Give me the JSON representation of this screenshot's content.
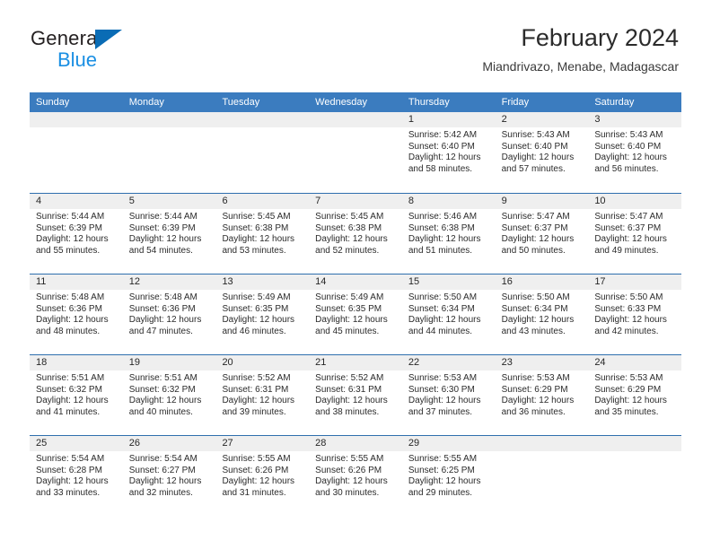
{
  "brand": {
    "name_top": "General",
    "name_bottom": "Blue",
    "accent_color": "#1a8fe3",
    "triangle_color": "#0a6cb5"
  },
  "header": {
    "title": "February 2024",
    "subtitle": "Miandrivazo, Menabe, Madagascar"
  },
  "calendar": {
    "header_color": "#3b7cbf",
    "row_divider_color": "#2f6fae",
    "day_strip_color": "#efefef",
    "weekdays": [
      "Sunday",
      "Monday",
      "Tuesday",
      "Wednesday",
      "Thursday",
      "Friday",
      "Saturday"
    ],
    "weeks": [
      [
        {
          "day": "",
          "sunrise": "",
          "sunset": "",
          "daylight_line1": "",
          "daylight_line2": ""
        },
        {
          "day": "",
          "sunrise": "",
          "sunset": "",
          "daylight_line1": "",
          "daylight_line2": ""
        },
        {
          "day": "",
          "sunrise": "",
          "sunset": "",
          "daylight_line1": "",
          "daylight_line2": ""
        },
        {
          "day": "",
          "sunrise": "",
          "sunset": "",
          "daylight_line1": "",
          "daylight_line2": ""
        },
        {
          "day": "1",
          "sunrise": "Sunrise: 5:42 AM",
          "sunset": "Sunset: 6:40 PM",
          "daylight_line1": "Daylight: 12 hours",
          "daylight_line2": "and 58 minutes."
        },
        {
          "day": "2",
          "sunrise": "Sunrise: 5:43 AM",
          "sunset": "Sunset: 6:40 PM",
          "daylight_line1": "Daylight: 12 hours",
          "daylight_line2": "and 57 minutes."
        },
        {
          "day": "3",
          "sunrise": "Sunrise: 5:43 AM",
          "sunset": "Sunset: 6:40 PM",
          "daylight_line1": "Daylight: 12 hours",
          "daylight_line2": "and 56 minutes."
        }
      ],
      [
        {
          "day": "4",
          "sunrise": "Sunrise: 5:44 AM",
          "sunset": "Sunset: 6:39 PM",
          "daylight_line1": "Daylight: 12 hours",
          "daylight_line2": "and 55 minutes."
        },
        {
          "day": "5",
          "sunrise": "Sunrise: 5:44 AM",
          "sunset": "Sunset: 6:39 PM",
          "daylight_line1": "Daylight: 12 hours",
          "daylight_line2": "and 54 minutes."
        },
        {
          "day": "6",
          "sunrise": "Sunrise: 5:45 AM",
          "sunset": "Sunset: 6:38 PM",
          "daylight_line1": "Daylight: 12 hours",
          "daylight_line2": "and 53 minutes."
        },
        {
          "day": "7",
          "sunrise": "Sunrise: 5:45 AM",
          "sunset": "Sunset: 6:38 PM",
          "daylight_line1": "Daylight: 12 hours",
          "daylight_line2": "and 52 minutes."
        },
        {
          "day": "8",
          "sunrise": "Sunrise: 5:46 AM",
          "sunset": "Sunset: 6:38 PM",
          "daylight_line1": "Daylight: 12 hours",
          "daylight_line2": "and 51 minutes."
        },
        {
          "day": "9",
          "sunrise": "Sunrise: 5:47 AM",
          "sunset": "Sunset: 6:37 PM",
          "daylight_line1": "Daylight: 12 hours",
          "daylight_line2": "and 50 minutes."
        },
        {
          "day": "10",
          "sunrise": "Sunrise: 5:47 AM",
          "sunset": "Sunset: 6:37 PM",
          "daylight_line1": "Daylight: 12 hours",
          "daylight_line2": "and 49 minutes."
        }
      ],
      [
        {
          "day": "11",
          "sunrise": "Sunrise: 5:48 AM",
          "sunset": "Sunset: 6:36 PM",
          "daylight_line1": "Daylight: 12 hours",
          "daylight_line2": "and 48 minutes."
        },
        {
          "day": "12",
          "sunrise": "Sunrise: 5:48 AM",
          "sunset": "Sunset: 6:36 PM",
          "daylight_line1": "Daylight: 12 hours",
          "daylight_line2": "and 47 minutes."
        },
        {
          "day": "13",
          "sunrise": "Sunrise: 5:49 AM",
          "sunset": "Sunset: 6:35 PM",
          "daylight_line1": "Daylight: 12 hours",
          "daylight_line2": "and 46 minutes."
        },
        {
          "day": "14",
          "sunrise": "Sunrise: 5:49 AM",
          "sunset": "Sunset: 6:35 PM",
          "daylight_line1": "Daylight: 12 hours",
          "daylight_line2": "and 45 minutes."
        },
        {
          "day": "15",
          "sunrise": "Sunrise: 5:50 AM",
          "sunset": "Sunset: 6:34 PM",
          "daylight_line1": "Daylight: 12 hours",
          "daylight_line2": "and 44 minutes."
        },
        {
          "day": "16",
          "sunrise": "Sunrise: 5:50 AM",
          "sunset": "Sunset: 6:34 PM",
          "daylight_line1": "Daylight: 12 hours",
          "daylight_line2": "and 43 minutes."
        },
        {
          "day": "17",
          "sunrise": "Sunrise: 5:50 AM",
          "sunset": "Sunset: 6:33 PM",
          "daylight_line1": "Daylight: 12 hours",
          "daylight_line2": "and 42 minutes."
        }
      ],
      [
        {
          "day": "18",
          "sunrise": "Sunrise: 5:51 AM",
          "sunset": "Sunset: 6:32 PM",
          "daylight_line1": "Daylight: 12 hours",
          "daylight_line2": "and 41 minutes."
        },
        {
          "day": "19",
          "sunrise": "Sunrise: 5:51 AM",
          "sunset": "Sunset: 6:32 PM",
          "daylight_line1": "Daylight: 12 hours",
          "daylight_line2": "and 40 minutes."
        },
        {
          "day": "20",
          "sunrise": "Sunrise: 5:52 AM",
          "sunset": "Sunset: 6:31 PM",
          "daylight_line1": "Daylight: 12 hours",
          "daylight_line2": "and 39 minutes."
        },
        {
          "day": "21",
          "sunrise": "Sunrise: 5:52 AM",
          "sunset": "Sunset: 6:31 PM",
          "daylight_line1": "Daylight: 12 hours",
          "daylight_line2": "and 38 minutes."
        },
        {
          "day": "22",
          "sunrise": "Sunrise: 5:53 AM",
          "sunset": "Sunset: 6:30 PM",
          "daylight_line1": "Daylight: 12 hours",
          "daylight_line2": "and 37 minutes."
        },
        {
          "day": "23",
          "sunrise": "Sunrise: 5:53 AM",
          "sunset": "Sunset: 6:29 PM",
          "daylight_line1": "Daylight: 12 hours",
          "daylight_line2": "and 36 minutes."
        },
        {
          "day": "24",
          "sunrise": "Sunrise: 5:53 AM",
          "sunset": "Sunset: 6:29 PM",
          "daylight_line1": "Daylight: 12 hours",
          "daylight_line2": "and 35 minutes."
        }
      ],
      [
        {
          "day": "25",
          "sunrise": "Sunrise: 5:54 AM",
          "sunset": "Sunset: 6:28 PM",
          "daylight_line1": "Daylight: 12 hours",
          "daylight_line2": "and 33 minutes."
        },
        {
          "day": "26",
          "sunrise": "Sunrise: 5:54 AM",
          "sunset": "Sunset: 6:27 PM",
          "daylight_line1": "Daylight: 12 hours",
          "daylight_line2": "and 32 minutes."
        },
        {
          "day": "27",
          "sunrise": "Sunrise: 5:55 AM",
          "sunset": "Sunset: 6:26 PM",
          "daylight_line1": "Daylight: 12 hours",
          "daylight_line2": "and 31 minutes."
        },
        {
          "day": "28",
          "sunrise": "Sunrise: 5:55 AM",
          "sunset": "Sunset: 6:26 PM",
          "daylight_line1": "Daylight: 12 hours",
          "daylight_line2": "and 30 minutes."
        },
        {
          "day": "29",
          "sunrise": "Sunrise: 5:55 AM",
          "sunset": "Sunset: 6:25 PM",
          "daylight_line1": "Daylight: 12 hours",
          "daylight_line2": "and 29 minutes."
        },
        {
          "day": "",
          "sunrise": "",
          "sunset": "",
          "daylight_line1": "",
          "daylight_line2": ""
        },
        {
          "day": "",
          "sunrise": "",
          "sunset": "",
          "daylight_line1": "",
          "daylight_line2": ""
        }
      ]
    ]
  }
}
